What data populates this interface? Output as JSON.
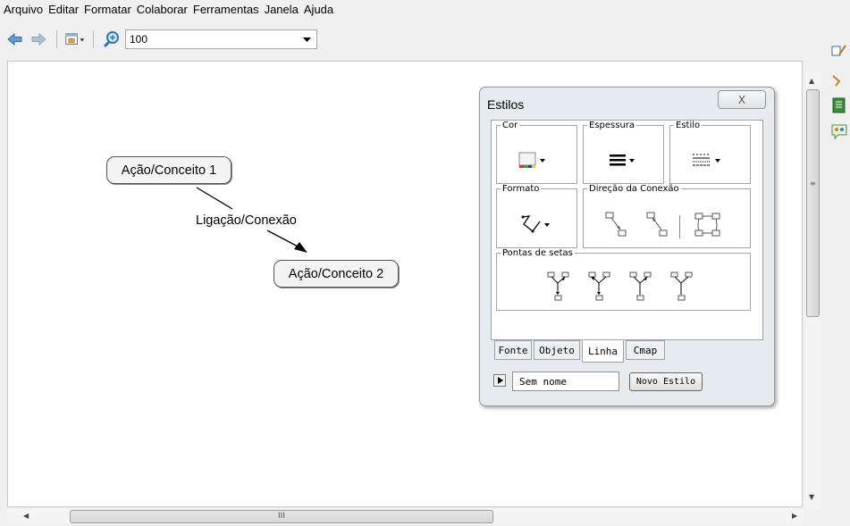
{
  "menu": [
    "Arquivo",
    "Editar",
    "Formatar",
    "Colaborar",
    "Ferramentas",
    "Janela",
    "Ajuda"
  ],
  "toolbar": {
    "zoom_value": "100",
    "icons": [
      "back-arrow-icon",
      "forward-arrow-icon",
      "view-options-icon",
      "zoom-icon"
    ]
  },
  "map": {
    "concept1": "Ação/Conceito 1",
    "linking_phrase": "Ligação/Conexão",
    "concept2": "Ação/Conceito 2"
  },
  "hscroll_label": "III",
  "dialog": {
    "title": "Estilos",
    "close_label": "X",
    "groups": {
      "color": "Cor",
      "thickness": "Espessura",
      "style": "Estilo",
      "format": "Formato",
      "direction": "Direção da Conexão",
      "arrowheads": "Pontas de setas"
    },
    "tabs": [
      "Fonte",
      "Objeto",
      "Linha",
      "Cmap"
    ],
    "active_tab": "Linha",
    "name_field_value": "Sem nome",
    "new_style_button": "Novo Estilo"
  },
  "colors": {
    "canvas": "#ffffff",
    "dialog_bg": "#e5ebef",
    "concept_bg": "#f4f4f4",
    "toolbar_icon": "#3b84c4"
  }
}
